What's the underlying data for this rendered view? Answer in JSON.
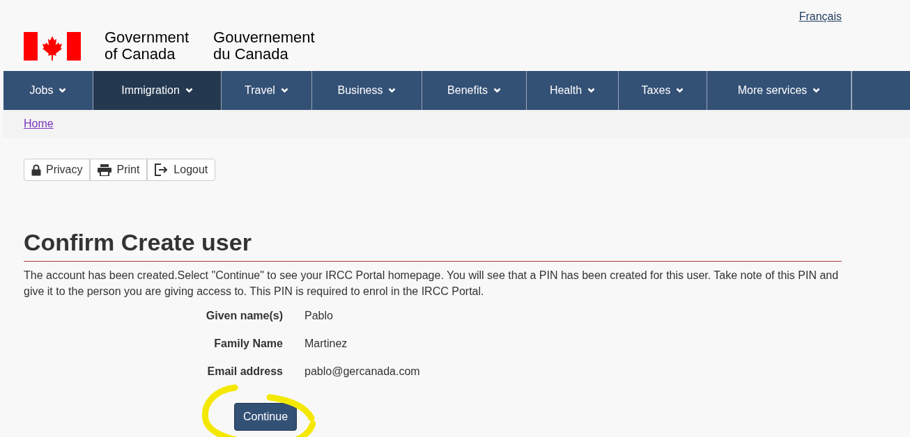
{
  "language_link": "Français",
  "brand": {
    "english": [
      "Government",
      "of Canada"
    ],
    "french": [
      "Gouvernement",
      "du Canada"
    ]
  },
  "nav": [
    {
      "label": "Jobs",
      "selected": false
    },
    {
      "label": "Immigration",
      "selected": true
    },
    {
      "label": "Travel",
      "selected": false
    },
    {
      "label": "Business",
      "selected": false
    },
    {
      "label": "Benefits",
      "selected": false
    },
    {
      "label": "Health",
      "selected": false
    },
    {
      "label": "Taxes",
      "selected": false
    },
    {
      "label": "More services",
      "selected": false
    }
  ],
  "breadcrumb": [
    "Home"
  ],
  "toolbar": [
    {
      "label": "Privacy",
      "kind": "lock"
    },
    {
      "label": "Print",
      "kind": "print"
    },
    {
      "label": "Logout",
      "kind": "logout"
    }
  ],
  "heading": "Confirm Create user",
  "message": "The account has been created.Select \"Continue\" to see your IRCC Portal homepage. You will see that a PIN has been created for this user. Take note of this PIN and give it to the person you are giving access to. This PIN is required to enrol in the IRCC Portal.",
  "details": [
    {
      "label": "Given name(s)",
      "value": "Pablo"
    },
    {
      "label": "Family Name",
      "value": "Martinez"
    },
    {
      "label": "Email address",
      "value": "pablo@gercanada.com"
    }
  ],
  "continue_button": "Continue"
}
